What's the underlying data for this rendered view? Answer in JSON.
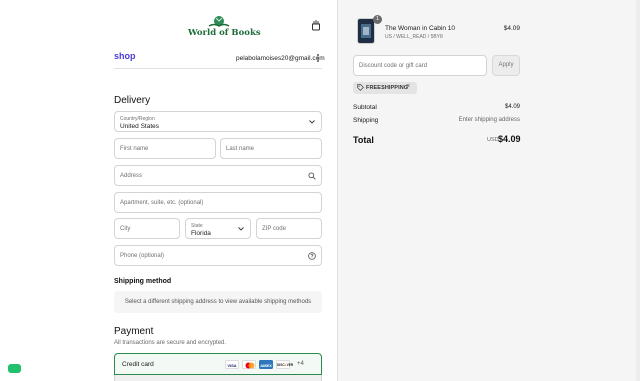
{
  "brand": {
    "logo_text": "World of Books",
    "logo_color": "#1f6b39"
  },
  "header": {
    "shop_label": "shop",
    "email": "pelabolamoises20@gmail.com"
  },
  "delivery": {
    "title": "Delivery",
    "country": {
      "label": "Country/Region",
      "value": "United States"
    },
    "first_name": {
      "placeholder": "First name"
    },
    "last_name": {
      "placeholder": "Last name"
    },
    "address": {
      "placeholder": "Address"
    },
    "apartment": {
      "placeholder": "Apartment, suite, etc. (optional)"
    },
    "city": {
      "placeholder": "City"
    },
    "state": {
      "label": "State",
      "value": "Florida"
    },
    "zip": {
      "placeholder": "ZIP code"
    },
    "phone": {
      "placeholder": "Phone (optional)"
    }
  },
  "shipping_method": {
    "title": "Shipping method",
    "notice": "Select a different shipping address to view available shipping methods"
  },
  "payment": {
    "title": "Payment",
    "subtitle": "All transactions are secure and encrypted.",
    "method_label": "Credit card",
    "cards": [
      "VISA",
      "mastercard",
      "AMEX",
      "DISCOVER"
    ],
    "more": "+4"
  },
  "order": {
    "product": {
      "title": "The Woman in Cabin 10",
      "variant": "US / WELL_READ / 5BY8",
      "price": "$4.09",
      "quantity": "1"
    },
    "discount": {
      "placeholder": "Discount code or gift card",
      "apply_label": "Apply"
    },
    "applied_code": "FREESHIPPING",
    "subtotal": {
      "label": "Subtotal",
      "value": "$4.09"
    },
    "shipping": {
      "label": "Shipping",
      "value": "Enter shipping address"
    },
    "total": {
      "label": "Total",
      "currency": "USD",
      "value": "$4.09"
    }
  },
  "colors": {
    "accent": "#4b3cd8",
    "selected_border": "#2d8a4e",
    "chat": "#20c06d"
  }
}
